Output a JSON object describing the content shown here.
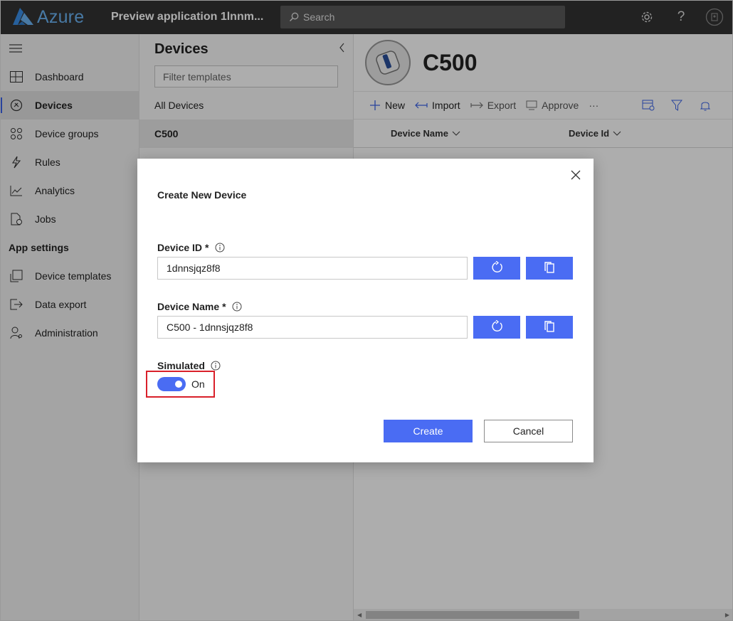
{
  "topbar": {
    "brand": "Azure",
    "app_title": "Preview application 1lnnm...",
    "search_placeholder": "Search"
  },
  "leftnav": {
    "items": [
      {
        "label": "Dashboard",
        "icon": "dashboard-icon"
      },
      {
        "label": "Devices",
        "icon": "devices-icon",
        "active": true
      },
      {
        "label": "Device groups",
        "icon": "device-groups-icon"
      },
      {
        "label": "Rules",
        "icon": "rules-icon"
      },
      {
        "label": "Analytics",
        "icon": "analytics-icon"
      },
      {
        "label": "Jobs",
        "icon": "jobs-icon"
      }
    ],
    "section_app_settings": "App settings",
    "settings_items": [
      {
        "label": "Device templates",
        "icon": "device-templates-icon"
      },
      {
        "label": "Data export",
        "icon": "data-export-icon"
      },
      {
        "label": "Administration",
        "icon": "administration-icon"
      }
    ]
  },
  "devices_panel": {
    "title": "Devices",
    "filter_placeholder": "Filter templates",
    "templates": [
      "All Devices",
      "C500"
    ],
    "selected": "C500"
  },
  "main": {
    "device_title": "C500",
    "toolbar": {
      "new": "New",
      "import": "Import",
      "export": "Export",
      "approve": "Approve",
      "more": "···"
    },
    "columns": [
      "Device Name",
      "Device Id"
    ]
  },
  "modal": {
    "title": "Create New Device",
    "device_id_label": "Device ID",
    "device_id_value": "1dnnsjqz8f8",
    "device_name_label": "Device Name",
    "device_name_value": "C500 - 1dnnsjqz8f8",
    "required_marker": "*",
    "simulated_label": "Simulated",
    "simulated_state": "On",
    "create_label": "Create",
    "cancel_label": "Cancel"
  },
  "colors": {
    "accent": "#4a6cf3",
    "topbar": "#333333",
    "brand": "#6ab3f2",
    "highlight": "#d9202a"
  }
}
